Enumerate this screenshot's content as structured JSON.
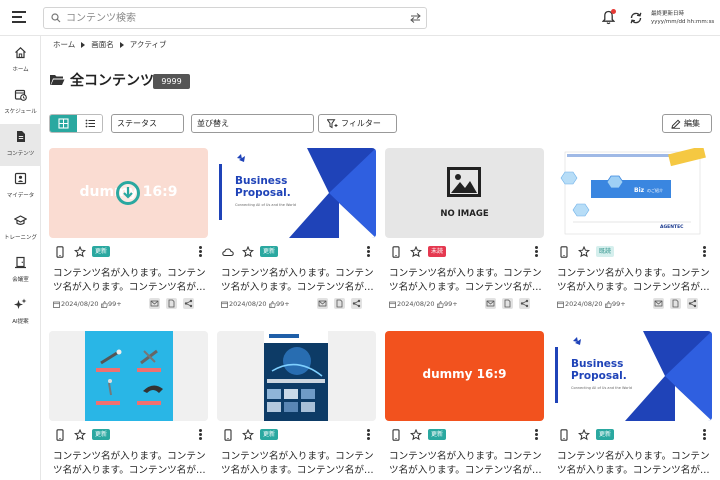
{
  "header": {
    "search_placeholder": "コンテンツ検索",
    "last_updated_label": "最終更新日時",
    "last_updated_value": "yyyy/mm/dd hh:mm:ss"
  },
  "sidebar": {
    "items": [
      {
        "label": "ホーム",
        "icon": "home-icon"
      },
      {
        "label": "スケジュール",
        "icon": "calendar-clock-icon"
      },
      {
        "label": "コンテンツ",
        "icon": "document-icon"
      },
      {
        "label": "マイデータ",
        "icon": "folder-user-icon"
      },
      {
        "label": "トレーニング",
        "icon": "graduation-cap-icon"
      },
      {
        "label": "会議室",
        "icon": "meeting-room-icon"
      },
      {
        "label": "AI提案",
        "icon": "sparkle-icon"
      }
    ],
    "active_index": 2
  },
  "breadcrumb": [
    "ホーム",
    "画面名",
    "アクティブ"
  ],
  "page": {
    "title": "全コンテンツ",
    "count": "9999"
  },
  "toolbar": {
    "status_label": "ステータス",
    "sort_label": "並び替え",
    "filter_label": "フィルター",
    "edit_label": "編集"
  },
  "thumbnail_text": {
    "dummy_16_9": "dummy 16:9",
    "no_image": "NO IMAGE",
    "business_proposal": "Business\nProposal.",
    "bp_sub": "Connecting All of Us and the World",
    "biz_label": "Biz",
    "biz_sub": "のご紹介",
    "agentec": "AGENTEC"
  },
  "cards": [
    {
      "title": "コンテンツ名が入ります。コンテン\nツ名が入ります。コンテンツ名が…",
      "tag": "更新",
      "tag_type": "new",
      "date": "2024/08/20",
      "likes": "99+",
      "device_icon": "smartphone-icon"
    },
    {
      "title": "コンテンツ名が入ります。コンテン\nツ名が入ります。コンテンツ名が…",
      "tag": "更新",
      "tag_type": "new",
      "date": "2024/08/20",
      "likes": "99+",
      "device_icon": "cloud-icon"
    },
    {
      "title": "コンテンツ名が入ります。コンテン\nツ名が入ります。コンテンツ名が…",
      "tag": "未読",
      "tag_type": "unread",
      "date": "2024/08/20",
      "likes": "99+",
      "device_icon": "smartphone-icon"
    },
    {
      "title": "コンテンツ名が入ります。コンテン\nツ名が入ります。コンテンツ名が…",
      "tag": "既読",
      "tag_type": "read",
      "date": "2024/08/20",
      "likes": "99+",
      "device_icon": "smartphone-icon"
    },
    {
      "title": "コンテンツ名が入ります。コンテン\nツ名が入ります。コンテンツ名が…",
      "tag": "更新",
      "tag_type": "new",
      "device_icon": "smartphone-icon"
    },
    {
      "title": "コンテンツ名が入ります。コンテン\nツ名が入ります。コンテンツ名が…",
      "tag": "更新",
      "tag_type": "new",
      "device_icon": "smartphone-icon"
    },
    {
      "title": "コンテンツ名が入ります。コンテン\nツ名が入ります。コンテンツ名が…",
      "tag": "更新",
      "tag_type": "new",
      "device_icon": "smartphone-icon"
    },
    {
      "title": "コンテンツ名が入ります。コンテン\nツ名が入ります。コンテンツ名が…",
      "tag": "更新",
      "tag_type": "new",
      "device_icon": "smartphone-icon"
    }
  ],
  "colors": {
    "accent": "#2aa8a0",
    "unread": "#e53950",
    "brand_blue": "#1f43b8",
    "dummy_orange": "#f2521e",
    "dummy_pink": "#fadcd2"
  }
}
